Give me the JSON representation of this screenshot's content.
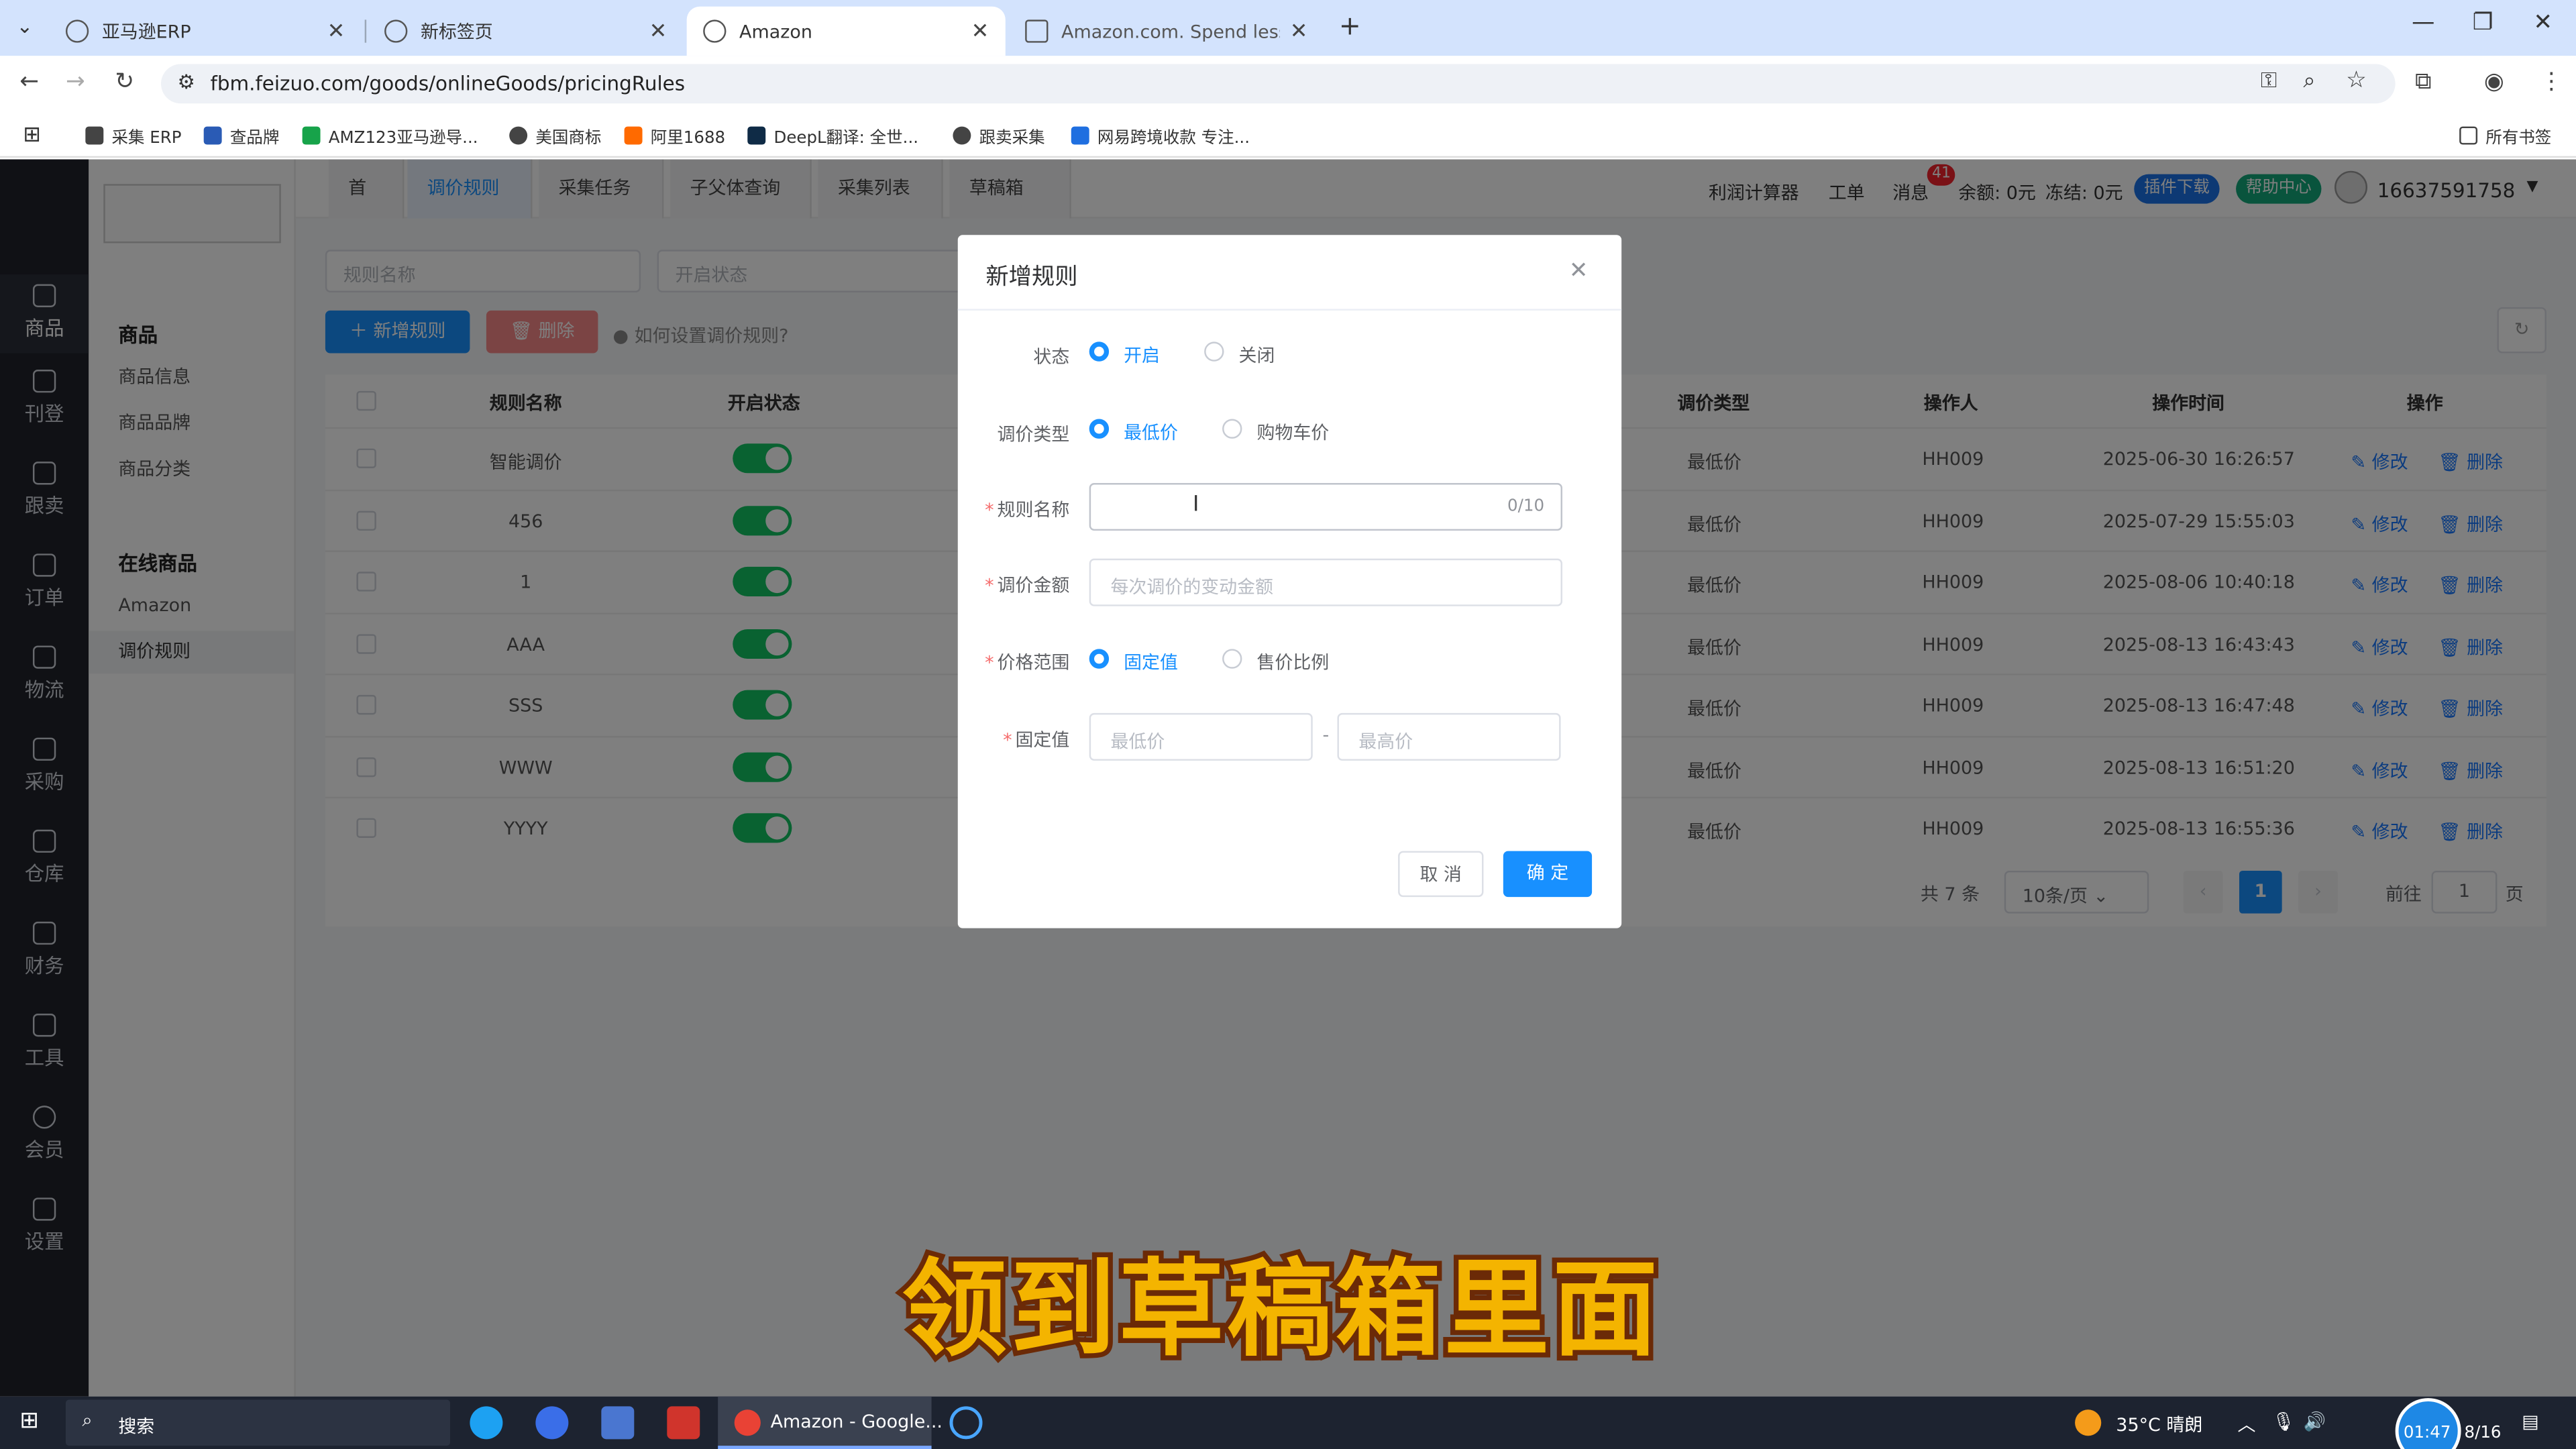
{
  "browser": {
    "tabs": [
      {
        "title": "亚马逊ERP",
        "active": false
      },
      {
        "title": "新标签页",
        "active": false
      },
      {
        "title": "Amazon",
        "active": true
      },
      {
        "title": "Amazon.com. Spend less. Sm",
        "active": false
      }
    ],
    "new_tab": "+",
    "url": "fbm.feizuo.com/goods/onlineGoods/pricingRules",
    "bookmarks": [
      "采集 ERP",
      "查品牌",
      "AMZ123亚马逊导...",
      "美国商标",
      "阿里1688",
      "DeepL翻译: 全世...",
      "跟卖采集",
      "网易跨境收款 专注..."
    ],
    "all_bookmarks": "所有书签"
  },
  "leftbar": [
    "商品",
    "刊登",
    "跟卖",
    "订单",
    "物流",
    "采购",
    "仓库",
    "财务",
    "工具",
    "会员",
    "设置"
  ],
  "sidebar": {
    "section1": "商品",
    "section1_items": [
      "商品信息",
      "商品品牌",
      "商品分类"
    ],
    "section2": "在线商品",
    "section2_items": [
      "Amazon",
      "调价规则"
    ]
  },
  "topnav": {
    "tabs": [
      "首页",
      "调价规则",
      "采集任务",
      "子父体查询",
      "采集列表",
      "草稿箱"
    ],
    "right": {
      "profit_calc": "利润计算器",
      "ticket": "工单",
      "messages": "消息",
      "msg_count": "41",
      "balance": "余额: 0元",
      "frozen": "冻结: 0元",
      "plugin": "插件下载",
      "help": "帮助中心",
      "phone": "16637591758"
    }
  },
  "filters": {
    "rule_name_placeholder": "规则名称",
    "status_placeholder": "开启状态"
  },
  "actions": {
    "add": "新增规则",
    "delete": "删除",
    "help_link": "如何设置调价规则?"
  },
  "table": {
    "headers": [
      "规则名称",
      "开启状态",
      "调价类型",
      "操作人",
      "操作时间",
      "操作"
    ],
    "rows": [
      {
        "name": "智能调价",
        "type": "最低价",
        "operator": "HH009",
        "time": "2025-06-30 16:26:57"
      },
      {
        "name": "456",
        "type": "最低价",
        "operator": "HH009",
        "time": "2025-07-29 15:55:03"
      },
      {
        "name": "1",
        "type": "最低价",
        "operator": "HH009",
        "time": "2025-08-06 10:40:18"
      },
      {
        "name": "AAA",
        "type": "最低价",
        "operator": "HH009",
        "time": "2025-08-13 16:43:43"
      },
      {
        "name": "SSS",
        "type": "最低价",
        "operator": "HH009",
        "time": "2025-08-13 16:47:48"
      },
      {
        "name": "WWW",
        "type": "最低价",
        "operator": "HH009",
        "time": "2025-08-13 16:51:20"
      },
      {
        "name": "YYYY",
        "type": "最低价",
        "operator": "HH009",
        "time": "2025-08-13 16:55:36"
      }
    ],
    "edit": "修改",
    "del": "删除"
  },
  "pagination": {
    "total": "共 7 条",
    "page_size": "10条/页",
    "current": "1",
    "goto_prefix": "前往",
    "goto_value": "1",
    "goto_suffix": "页"
  },
  "dialog": {
    "title": "新增规则",
    "status_label": "状态",
    "status_on": "开启",
    "status_off": "关闭",
    "type_label": "调价类型",
    "type_lowest": "最低价",
    "type_cart": "购物车价",
    "name_label": "规则名称",
    "name_counter": "0/10",
    "amount_label": "调价金额",
    "amount_placeholder": "每次调价的变动金额",
    "range_label": "价格范围",
    "range_fixed": "固定值",
    "range_ratio": "售价比例",
    "fixed_label": "固定值",
    "min_placeholder": "最低价",
    "max_placeholder": "最高价",
    "dash": "-",
    "cancel": "取 消",
    "confirm": "确 定"
  },
  "caption": "领到草稿箱里面",
  "taskbar": {
    "search": "搜索",
    "app": "Amazon - Google...",
    "weather": "35°C 晴朗",
    "clock_time": "01:47",
    "clock_date": "8/16"
  }
}
